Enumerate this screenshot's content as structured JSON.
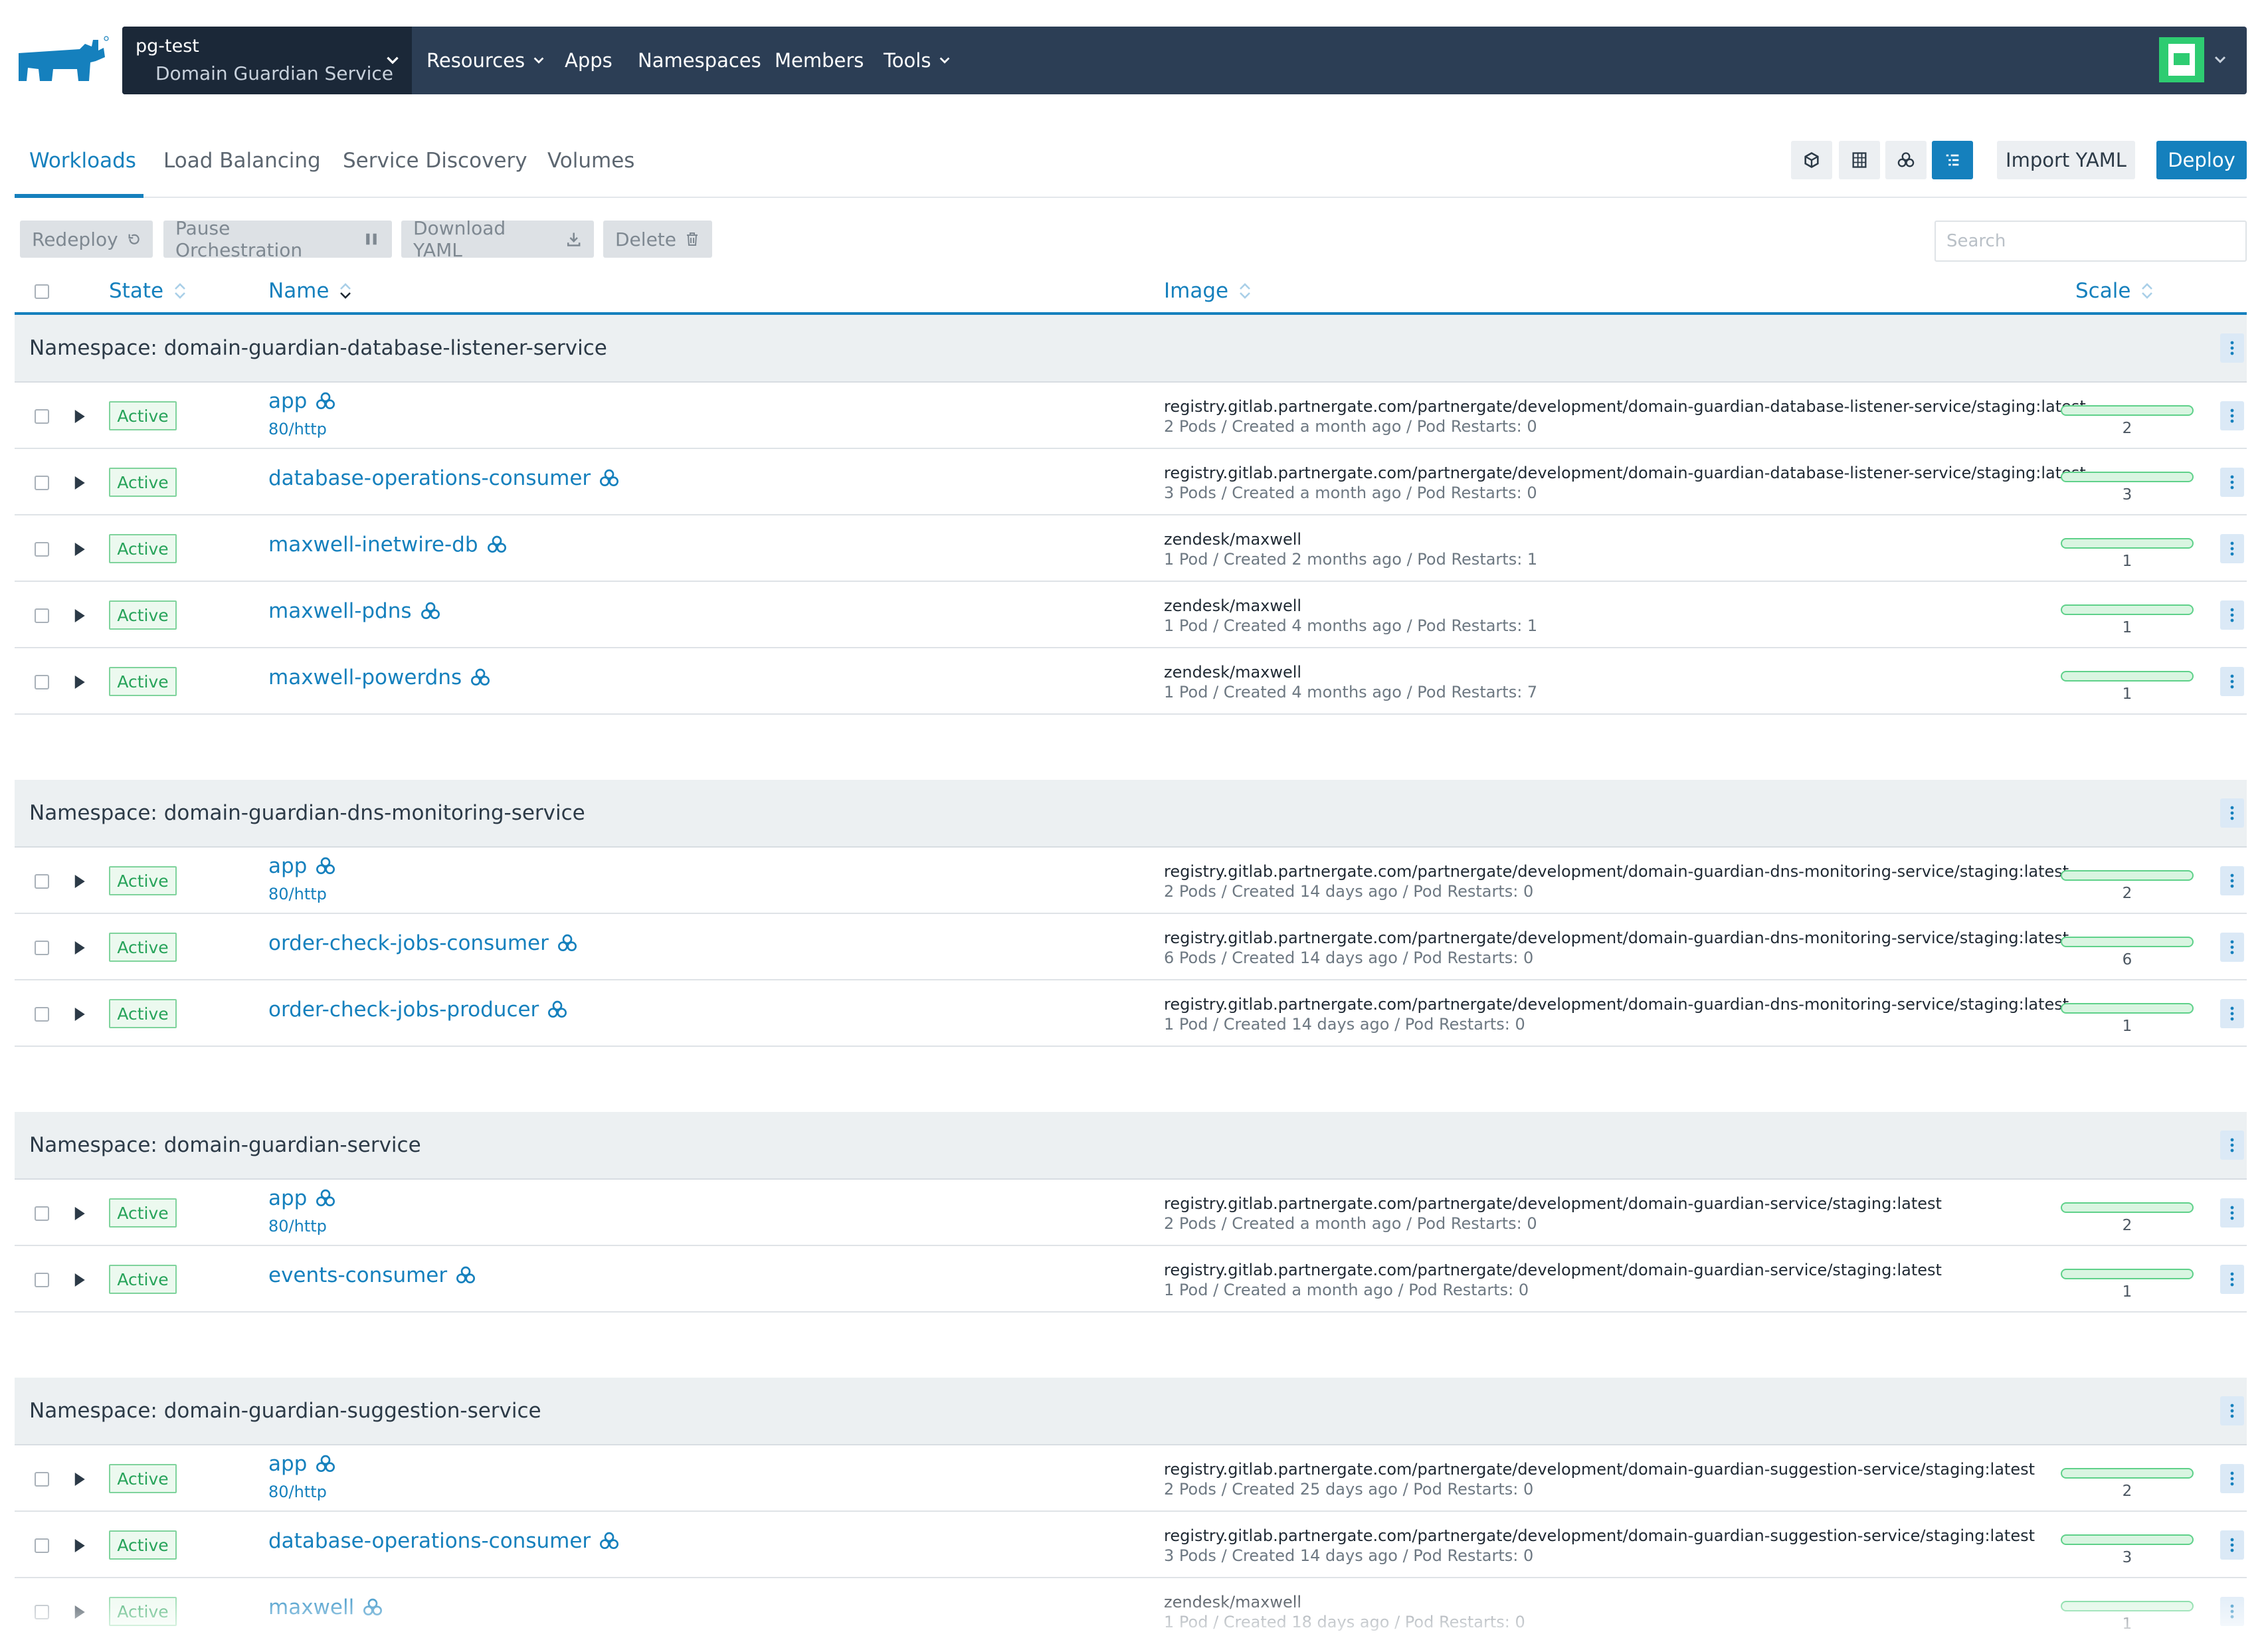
{
  "header": {
    "context_project": "pg-test",
    "context_cluster": "Domain Guardian Service",
    "nav": [
      "Resources",
      "Apps",
      "Namespaces",
      "Members",
      "Tools"
    ]
  },
  "tabs": [
    "Workloads",
    "Load Balancing",
    "Service Discovery",
    "Volumes"
  ],
  "toolbar": {
    "import_label": "Import YAML",
    "deploy_label": "Deploy"
  },
  "actions": [
    "Redeploy",
    "Pause Orchestration",
    "Download YAML",
    "Delete"
  ],
  "search": {
    "placeholder": "Search"
  },
  "columns": {
    "state": "State",
    "name": "Name",
    "image": "Image",
    "scale": "Scale"
  },
  "colors": {
    "accent": "#1580bd",
    "active": "#27a35a",
    "header_bg": "#2c3e55"
  },
  "groups": [
    {
      "title": "Namespace: domain-guardian-database-listener-service",
      "rows": [
        {
          "state": "Active",
          "name": "app",
          "endpoint": "80/http",
          "image": "registry.gitlab.partnergate.com/partnergate/development/domain-guardian-database-listener-service/staging:latest",
          "meta": "2 Pods / Created a month ago / Pod Restarts: 0",
          "scale": "2"
        },
        {
          "state": "Active",
          "name": "database-operations-consumer",
          "endpoint": "",
          "image": "registry.gitlab.partnergate.com/partnergate/development/domain-guardian-database-listener-service/staging:latest",
          "meta": "3 Pods / Created a month ago / Pod Restarts: 0",
          "scale": "3"
        },
        {
          "state": "Active",
          "name": "maxwell-inetwire-db",
          "endpoint": "",
          "image": "zendesk/maxwell",
          "meta": "1 Pod / Created 2 months ago / Pod Restarts: 1",
          "scale": "1"
        },
        {
          "state": "Active",
          "name": "maxwell-pdns",
          "endpoint": "",
          "image": "zendesk/maxwell",
          "meta": "1 Pod / Created 4 months ago / Pod Restarts: 1",
          "scale": "1"
        },
        {
          "state": "Active",
          "name": "maxwell-powerdns",
          "endpoint": "",
          "image": "zendesk/maxwell",
          "meta": "1 Pod / Created 4 months ago / Pod Restarts: 7",
          "scale": "1"
        }
      ]
    },
    {
      "title": "Namespace: domain-guardian-dns-monitoring-service",
      "rows": [
        {
          "state": "Active",
          "name": "app",
          "endpoint": "80/http",
          "image": "registry.gitlab.partnergate.com/partnergate/development/domain-guardian-dns-monitoring-service/staging:latest",
          "meta": "2 Pods / Created 14 days ago / Pod Restarts: 0",
          "scale": "2"
        },
        {
          "state": "Active",
          "name": "order-check-jobs-consumer",
          "endpoint": "",
          "image": "registry.gitlab.partnergate.com/partnergate/development/domain-guardian-dns-monitoring-service/staging:latest",
          "meta": "6 Pods / Created 14 days ago / Pod Restarts: 0",
          "scale": "6"
        },
        {
          "state": "Active",
          "name": "order-check-jobs-producer",
          "endpoint": "",
          "image": "registry.gitlab.partnergate.com/partnergate/development/domain-guardian-dns-monitoring-service/staging:latest",
          "meta": "1 Pod / Created 14 days ago / Pod Restarts: 0",
          "scale": "1"
        }
      ]
    },
    {
      "title": "Namespace: domain-guardian-service",
      "rows": [
        {
          "state": "Active",
          "name": "app",
          "endpoint": "80/http",
          "image": "registry.gitlab.partnergate.com/partnergate/development/domain-guardian-service/staging:latest",
          "meta": "2 Pods / Created a month ago / Pod Restarts: 0",
          "scale": "2"
        },
        {
          "state": "Active",
          "name": "events-consumer",
          "endpoint": "",
          "image": "registry.gitlab.partnergate.com/partnergate/development/domain-guardian-service/staging:latest",
          "meta": "1 Pod / Created a month ago / Pod Restarts: 0",
          "scale": "1"
        }
      ]
    },
    {
      "title": "Namespace: domain-guardian-suggestion-service",
      "rows": [
        {
          "state": "Active",
          "name": "app",
          "endpoint": "80/http",
          "image": "registry.gitlab.partnergate.com/partnergate/development/domain-guardian-suggestion-service/staging:latest",
          "meta": "2 Pods / Created 25 days ago / Pod Restarts: 0",
          "scale": "2"
        },
        {
          "state": "Active",
          "name": "database-operations-consumer",
          "endpoint": "",
          "image": "registry.gitlab.partnergate.com/partnergate/development/domain-guardian-suggestion-service/staging:latest",
          "meta": "3 Pods / Created 14 days ago / Pod Restarts: 0",
          "scale": "3"
        },
        {
          "state": "Active",
          "name": "maxwell",
          "endpoint": "",
          "image": "zendesk/maxwell",
          "meta": "1 Pod / Created 18 days ago / Pod Restarts: 0",
          "scale": "1"
        }
      ]
    }
  ]
}
